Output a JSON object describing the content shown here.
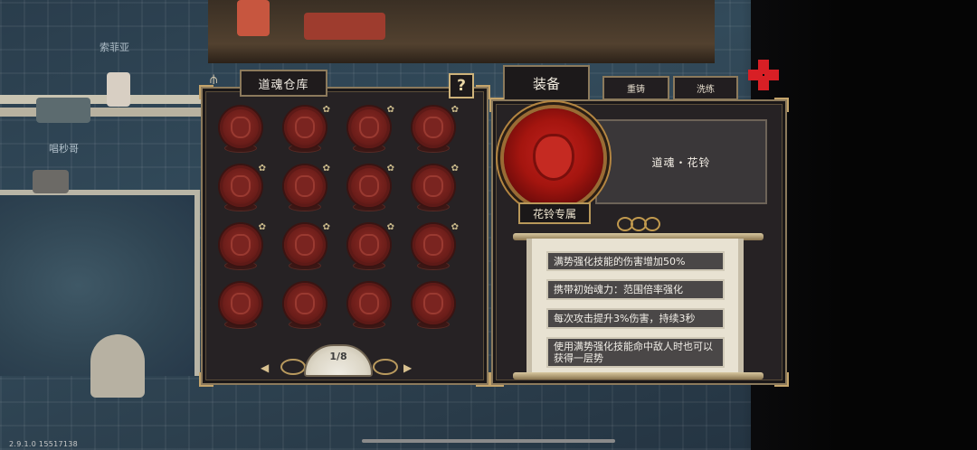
{
  "scene": {
    "npc_label_1": "索菲亚",
    "npc_label_2": "唱秒哥"
  },
  "version": "2.9.1.0 15517138",
  "warehouse": {
    "title": "道魂仓库",
    "help_label": "?",
    "page": "1/8",
    "prev_label": "◀",
    "next_label": "▶",
    "slots": [
      {
        "starred": false
      },
      {
        "starred": true
      },
      {
        "starred": true
      },
      {
        "starred": true
      },
      {
        "starred": true
      },
      {
        "starred": true
      },
      {
        "starred": true
      },
      {
        "starred": true
      },
      {
        "starred": true
      },
      {
        "starred": true
      },
      {
        "starred": true
      },
      {
        "starred": true
      },
      {
        "starred": false
      },
      {
        "starred": false
      },
      {
        "starred": false
      },
      {
        "starred": false
      }
    ]
  },
  "tabs": {
    "equip": "装备",
    "recast": "重铸",
    "refine": "洗练"
  },
  "equipped": {
    "name": "道魂・花铃",
    "exclusive": "花铃专属",
    "effects": [
      "满势强化技能的伤害增加50%",
      "携带初始魂力：范围倍率强化",
      "每次攻击提升3%伤害，持续3秒",
      "使用满势强化技能命中敌人时也可以获得一层势"
    ]
  },
  "colors": {
    "panel_bg": "#262224",
    "border_gold": "#8c7a5c",
    "orb_red": "#c2221e",
    "pinwheel_red": "#d81f25"
  }
}
